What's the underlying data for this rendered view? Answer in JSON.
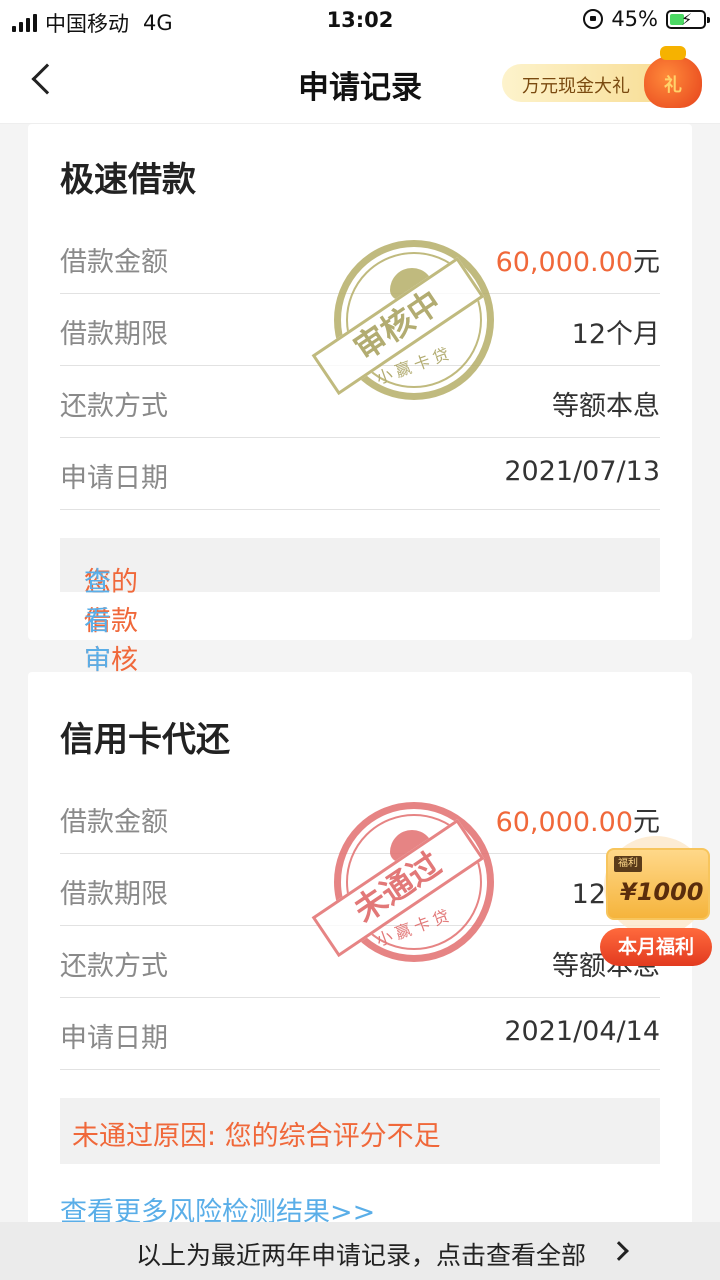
{
  "status_bar": {
    "carrier": "中国移动",
    "network": "4G",
    "time": "13:02",
    "battery": "45%",
    "battery_level": 0.45
  },
  "nav": {
    "title": "申请记录",
    "promo_label": "万元现金大礼",
    "bag_char": "礼"
  },
  "records": [
    {
      "title": "极速借款",
      "stamp": {
        "text": "审核中",
        "bottom": "小赢卡贷"
      },
      "rows": [
        {
          "label": "借款金额",
          "value": "60,000.00",
          "unit": "元"
        },
        {
          "label": "借款期限",
          "value": "12个月"
        },
        {
          "label": "还款方式",
          "value": "等额本息"
        },
        {
          "label": "申请日期",
          "value": "2021/07/13"
        }
      ],
      "notice": {
        "text": "您的借款审核中，",
        "link": "查看审核流程>>"
      }
    },
    {
      "title": "信用卡代还",
      "stamp": {
        "text": "未通过",
        "bottom": "小赢卡贷"
      },
      "rows": [
        {
          "label": "借款金额",
          "value": "60,000.00",
          "unit": "元"
        },
        {
          "label": "借款期限",
          "value": "12个月"
        },
        {
          "label": "还款方式",
          "value": "等额本息"
        },
        {
          "label": "申请日期",
          "value": "2021/04/14"
        }
      ],
      "notice": {
        "text": "未通过原因: 您的综合评分不足"
      },
      "more_link": "查看更多风险检测结果>>"
    }
  ],
  "welfare": {
    "tag": "福利",
    "amount": "¥1000",
    "label": "本月福利"
  },
  "footer": {
    "text": "以上为最近两年申请记录，点击查看全部"
  },
  "colors": {
    "amount": "#f0683a",
    "link": "#5aaee8",
    "stamp_pending": "#b3ab62",
    "stamp_rejected": "#e16a6a"
  }
}
